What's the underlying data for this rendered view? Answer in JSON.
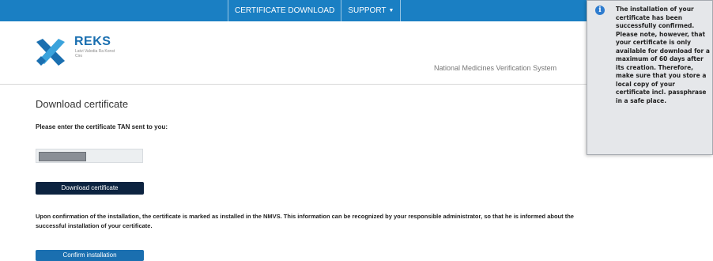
{
  "nav": {
    "items": [
      {
        "label": "CERTIFICATE DOWNLOAD"
      },
      {
        "label": "SUPPORT"
      }
    ]
  },
  "brand": {
    "name": "REKS",
    "subtitle": "Latvi Valodia Ra Konst Ciro"
  },
  "header": {
    "system_name": "National Medicines Verification System"
  },
  "page": {
    "title": "Download certificate",
    "tan_prompt": "Please enter the certificate TAN sent to you:",
    "download_button": "Download certificate",
    "info_text": "Upon confirmation of the installation, the certificate is marked as installed in the NMVS. This information can be recognized by your responsible administrator, so that he is informed about the successful installation of your certificate.",
    "confirm_button": "Confirm installation"
  },
  "tooltip": {
    "icon": "info-icon",
    "text": "The installation of your certificate has been successfully confirmed. Please note, however, that your certificate is only available for download for a maximum of 60 days after its creation. Therefore, make sure that you store a local copy of your certificate incl. passphrase in a safe place."
  },
  "colors": {
    "topbar": "#1a7fc3",
    "brand_dark": "#1a6fb0",
    "brand_light": "#3ba3dc",
    "download_button": "#0c2340",
    "confirm_button": "#1a6fb0"
  }
}
